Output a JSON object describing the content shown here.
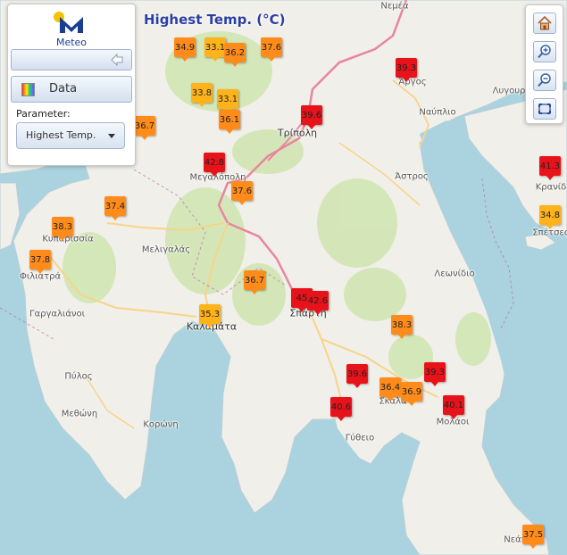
{
  "map_title": "Highest Temp. (°C)",
  "logo": {
    "text": "Meteo"
  },
  "panel": {
    "data_label": "Data",
    "parameter_label": "Parameter:",
    "parameter_value": "Highest Temp."
  },
  "toolbar": {
    "home": "home-icon",
    "zoom_in": "zoom-in-icon",
    "zoom_out": "zoom-out-icon",
    "full_extent": "full-extent-icon"
  },
  "colors": {
    "water": "#aad3df",
    "land": "#f1efe9",
    "road_primary": "#e8869e",
    "road_secondary": "#f7d48a",
    "hot": "#e8131a",
    "warm": "#ff8c1a",
    "mild": "#ffb31a"
  },
  "places": [
    {
      "name": "Νεμέα",
      "town": false
    },
    {
      "name": "Άργος",
      "town": false
    },
    {
      "name": "Λυγουρ",
      "town": false
    },
    {
      "name": "Ναύπλιο",
      "town": false
    },
    {
      "name": "Τρίπολη",
      "town": true
    },
    {
      "name": "Μεγαλόπολη",
      "town": false
    },
    {
      "name": "Άστρος",
      "town": false
    },
    {
      "name": "Κρανίδ",
      "town": false
    },
    {
      "name": "Σπέτσες",
      "town": false
    },
    {
      "name": "Κυπαρισσία",
      "town": false
    },
    {
      "name": "Φιλιατρά",
      "town": false
    },
    {
      "name": "Μελιγαλάς",
      "town": false
    },
    {
      "name": "Λεωνίδιο",
      "town": false
    },
    {
      "name": "Σπάρτη",
      "town": true
    },
    {
      "name": "Γαργαλιάνοι",
      "town": false
    },
    {
      "name": "Καλαμάτα",
      "town": true
    },
    {
      "name": "Πύλος",
      "town": false
    },
    {
      "name": "Σκάλα",
      "town": false
    },
    {
      "name": "Μεθώνη",
      "town": false
    },
    {
      "name": "Μολάοι",
      "town": false
    },
    {
      "name": "Κορώνη",
      "town": false
    },
    {
      "name": "Γύθειο",
      "town": false
    },
    {
      "name": "Νεάπ",
      "town": false
    }
  ],
  "stations": [
    {
      "value": "34.9",
      "level": "warm"
    },
    {
      "value": "33.1",
      "level": "mild"
    },
    {
      "value": "36.2",
      "level": "warm"
    },
    {
      "value": "37.6",
      "level": "warm"
    },
    {
      "value": "39.3",
      "level": "hot"
    },
    {
      "value": "33.8",
      "level": "mild"
    },
    {
      "value": "33.1",
      "level": "mild"
    },
    {
      "value": "36.1",
      "level": "warm"
    },
    {
      "value": "36.7",
      "level": "warm"
    },
    {
      "value": "39.6",
      "level": "hot"
    },
    {
      "value": "42.8",
      "level": "hot"
    },
    {
      "value": "37.6",
      "level": "warm"
    },
    {
      "value": "41.3",
      "level": "hot"
    },
    {
      "value": "37.4",
      "level": "warm"
    },
    {
      "value": "38.3",
      "level": "warm"
    },
    {
      "value": "34.8",
      "level": "mild"
    },
    {
      "value": "37.8",
      "level": "warm"
    },
    {
      "value": "36.7",
      "level": "warm"
    },
    {
      "value": "45",
      "level": "hot"
    },
    {
      "value": "42.6",
      "level": "hot"
    },
    {
      "value": "35.3",
      "level": "mild"
    },
    {
      "value": "38.3",
      "level": "warm"
    },
    {
      "value": "39.6",
      "level": "hot"
    },
    {
      "value": "39.3",
      "level": "hot"
    },
    {
      "value": "36.4",
      "level": "warm"
    },
    {
      "value": "36.9",
      "level": "warm"
    },
    {
      "value": "40.6",
      "level": "hot"
    },
    {
      "value": "40.1",
      "level": "hot"
    },
    {
      "value": "37.5",
      "level": "warm"
    }
  ]
}
